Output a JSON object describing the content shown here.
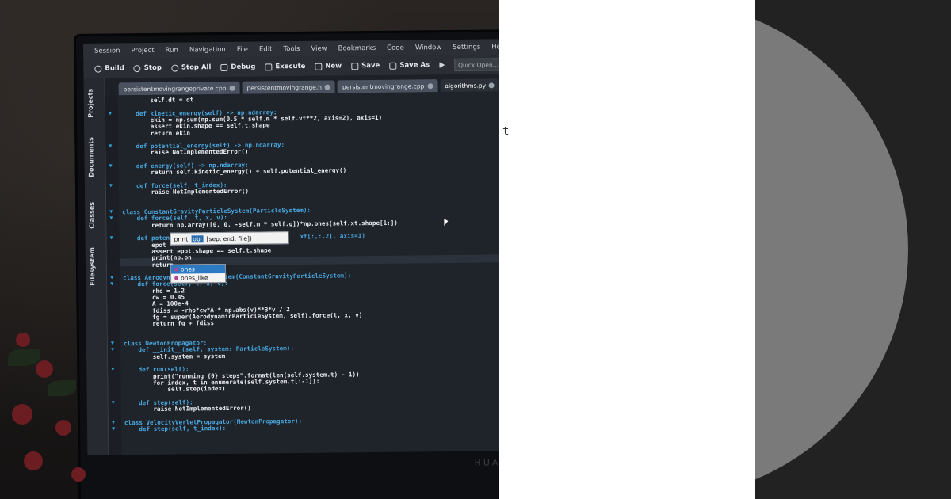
{
  "menu": [
    "Session",
    "Project",
    "Run",
    "Navigation",
    "File",
    "Edit",
    "Tools",
    "View",
    "Bookmarks",
    "Code",
    "Window",
    "Settings",
    "Help"
  ],
  "toolbar": {
    "build": "Build",
    "stop": "Stop",
    "stop_all": "Stop All",
    "debug": "Debug",
    "execute": "Execute",
    "new": "New",
    "save": "Save",
    "save_as": "Save As",
    "quick_open_placeholder": "Quick Open..."
  },
  "side_tabs": [
    "Projects",
    "Documents",
    "Classes",
    "Filesystem"
  ],
  "file_tabs": [
    {
      "name": "persistentmovingrangeprivate.cpp",
      "active": false
    },
    {
      "name": "persistentmovingrange.h",
      "active": false
    },
    {
      "name": "persistentmovingrange.cpp",
      "active": false
    },
    {
      "name": "algorithms.py",
      "active": true
    }
  ],
  "code_lines": [
    "        self.dt = dt",
    "",
    "    def kinetic_energy(self) -> np.ndarray:",
    "        ekin = np.sum(np.sum(0.5 * self.m * self.vt**2, axis=2), axis=1)",
    "        assert ekin.shape == self.t.shape",
    "        return ekin",
    "",
    "    def potential_energy(self) -> np.ndarray:",
    "        raise NotImplementedError()",
    "",
    "    def energy(self) -> np.ndarray:",
    "        return self.kinetic_energy() + self.potential_energy()",
    "",
    "    def force(self, t_index):",
    "        raise NotImplementedError()",
    "",
    "",
    "class ConstantGravityParticleSystem(ParticleSystem):",
    "    def force(self, t, x, v):",
    "        return np.array([0, 0, -self.m * self.g])*np.ones(self.xt.shape[1:])",
    "",
    "    def poten                                    xt[:,:,2], axis=1)",
    "        epot",
    "        assert epot.shape == self.t.shape",
    "        print(np.on",
    "        return",
    "",
    "class AerodynamicParticleSystem(ConstantGravityParticleSystem):",
    "    def force(self, t, x, v):",
    "        rho = 1.2",
    "        cw = 0.45",
    "        A = 100e-4",
    "        fdiss = -rho*cw*A * np.abs(v)**3*v / 2",
    "        fg = super(AerodynamicParticleSystem, self).force(t, x, v)",
    "        return fg + fdiss",
    "",
    "",
    "class NewtonPropagator:",
    "    def __init__(self, system: ParticleSystem):",
    "        self.system = system",
    "",
    "    def run(self):",
    "        print(\"running {0} steps\".format(len(self.system.t) - 1))",
    "        for index, t in enumerate(self.system.t[:-1]):",
    "            self.step(index)",
    "",
    "    def step(self):",
    "        raise NotImplementedError()",
    "",
    "class VelocityVerletPropagator(NewtonPropagator):",
    "    def step(self, t_index):"
  ],
  "calltip": {
    "name": "print",
    "current_arg": "obj",
    "rest": "[sep, end, file])"
  },
  "completion": [
    "ones",
    "ones_like"
  ],
  "monitor_brand": "HUAWEI",
  "stray_text": "t",
  "colors": {
    "keyword": "#4aa8e0",
    "function": "#f2c14e",
    "number": "#f37b8f",
    "builtin": "#8fd18a",
    "selection": "#2d7ac4",
    "right_panel_bg": "#ffffff",
    "disc": "#7a7a7a",
    "strip": "#222222"
  }
}
